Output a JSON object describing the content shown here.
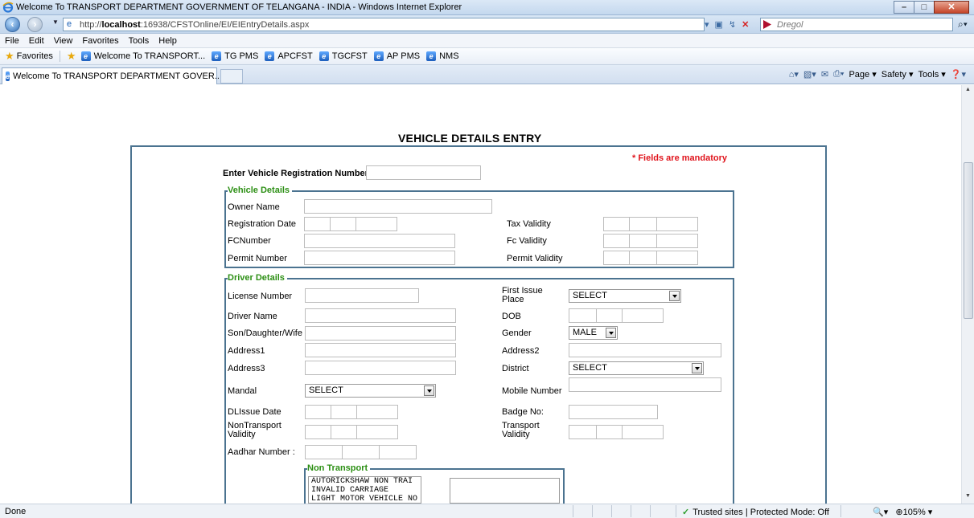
{
  "window": {
    "title": "Welcome To TRANSPORT DEPARTMENT GOVERNMENT OF TELANGANA - INDIA - Windows Internet Explorer",
    "controls": {
      "minimize": "–",
      "maximize": "□",
      "close": "✕"
    }
  },
  "address_bar": {
    "url_prefix": "http://",
    "url_host": "localhost",
    "url_rest": ":16938/CFSTOnline/EI/EIEntryDetails.aspx",
    "search_text": "Dregol"
  },
  "menu": [
    "File",
    "Edit",
    "View",
    "Favorites",
    "Tools",
    "Help"
  ],
  "favorites_bar": {
    "favorites_label": "Favorites",
    "links": [
      "Welcome To TRANSPORT...",
      "TG PMS",
      "APCFST",
      "TGCFST",
      "AP PMS",
      "NMS"
    ]
  },
  "tab": {
    "label": "Welcome To TRANSPORT DEPARTMENT GOVER..."
  },
  "command_bar": {
    "page": "Page",
    "safety": "Safety",
    "tools": "Tools"
  },
  "form": {
    "title": "VEHICLE DETAILS ENTRY",
    "mandatory_note": "* Fields are mandatory",
    "reg_label": "Enter Vehicle Registration Number:",
    "vehicle_details": {
      "legend": "Vehicle Details",
      "owner_name": "Owner Name",
      "registration_date": "Registration Date",
      "fc_number": "FCNumber",
      "permit_number": "Permit Number",
      "tax_validity": "Tax Validity",
      "fc_validity": "Fc Validity",
      "permit_validity": "Permit Validity"
    },
    "driver_details": {
      "legend": "Driver Details",
      "license_number": "License Number",
      "driver_name": "Driver Name",
      "relation": "Son/Daughter/Wife",
      "address1": "Address1",
      "address3": "Address3",
      "mandal": "Mandal",
      "dl_issue_date": "DLIssue Date",
      "nontransport_validity": "NonTransport Validity",
      "aadhar_number": "Aadhar Number :",
      "first_issue_place": "First Issue Place",
      "dob": "DOB",
      "gender": "Gender",
      "address2": "Address2",
      "district": "District",
      "mobile_number": "Mobile Number",
      "badge_no": "Badge No:",
      "transport_validity": "Transport Validity",
      "first_issue_place_value": "SELECT",
      "gender_value": "MALE",
      "district_value": "SELECT",
      "mandal_value": "SELECT"
    },
    "non_transport": {
      "legend": "Non Transport",
      "items": [
        "AUTORICKSHAW NON TRAI",
        "INVALID CARRIAGE",
        "LIGHT MOTOR VEHICLE NO"
      ]
    }
  },
  "status_bar": {
    "left": "Done",
    "zone": "Trusted sites | Protected Mode: Off",
    "zoom": "105%"
  }
}
